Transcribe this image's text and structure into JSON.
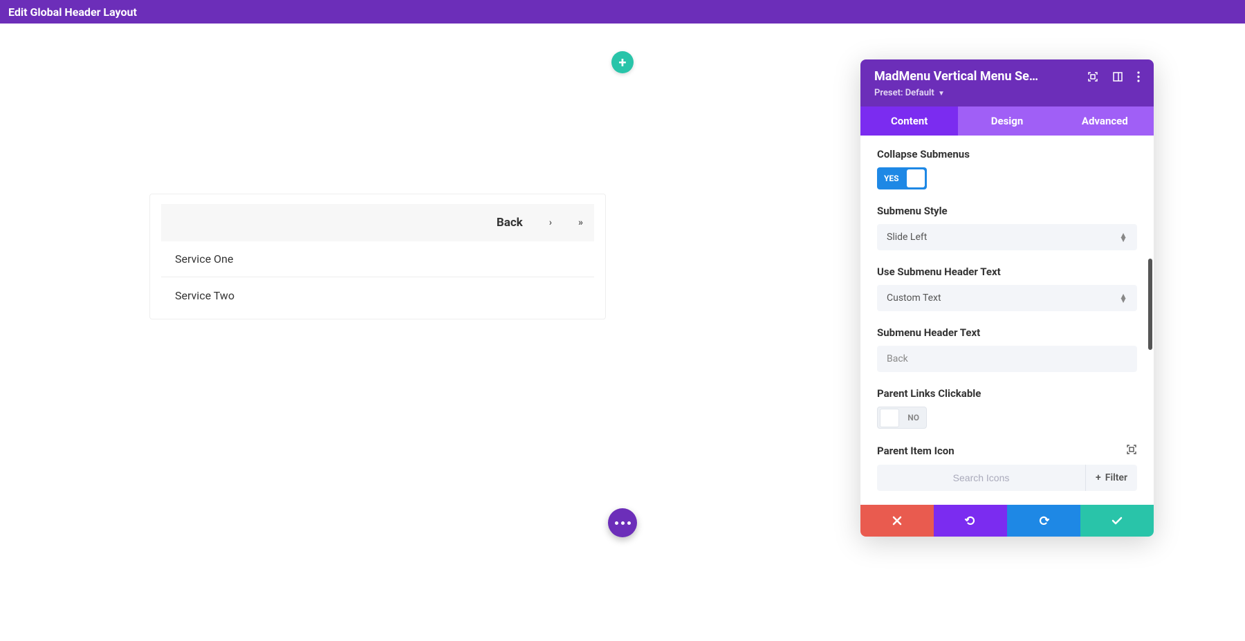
{
  "top_bar": {
    "title": "Edit Global Header Layout"
  },
  "menu_preview": {
    "back_label": "Back",
    "items": [
      "Service One",
      "Service Two"
    ]
  },
  "panel": {
    "title": "MadMenu Vertical Menu Se…",
    "preset_label": "Preset:",
    "preset_value": "Default",
    "tabs": {
      "content": "Content",
      "design": "Design",
      "advanced": "Advanced"
    },
    "fields": {
      "collapse_label": "Collapse Submenus",
      "collapse_value": "YES",
      "submenu_style_label": "Submenu Style",
      "submenu_style_value": "Slide Left",
      "use_header_text_label": "Use Submenu Header Text",
      "use_header_text_value": "Custom Text",
      "header_text_label": "Submenu Header Text",
      "header_text_value": "Back",
      "parent_clickable_label": "Parent Links Clickable",
      "parent_clickable_value": "NO",
      "parent_icon_label": "Parent Item Icon",
      "search_icons_placeholder": "Search Icons",
      "filter_label": "Filter"
    }
  }
}
